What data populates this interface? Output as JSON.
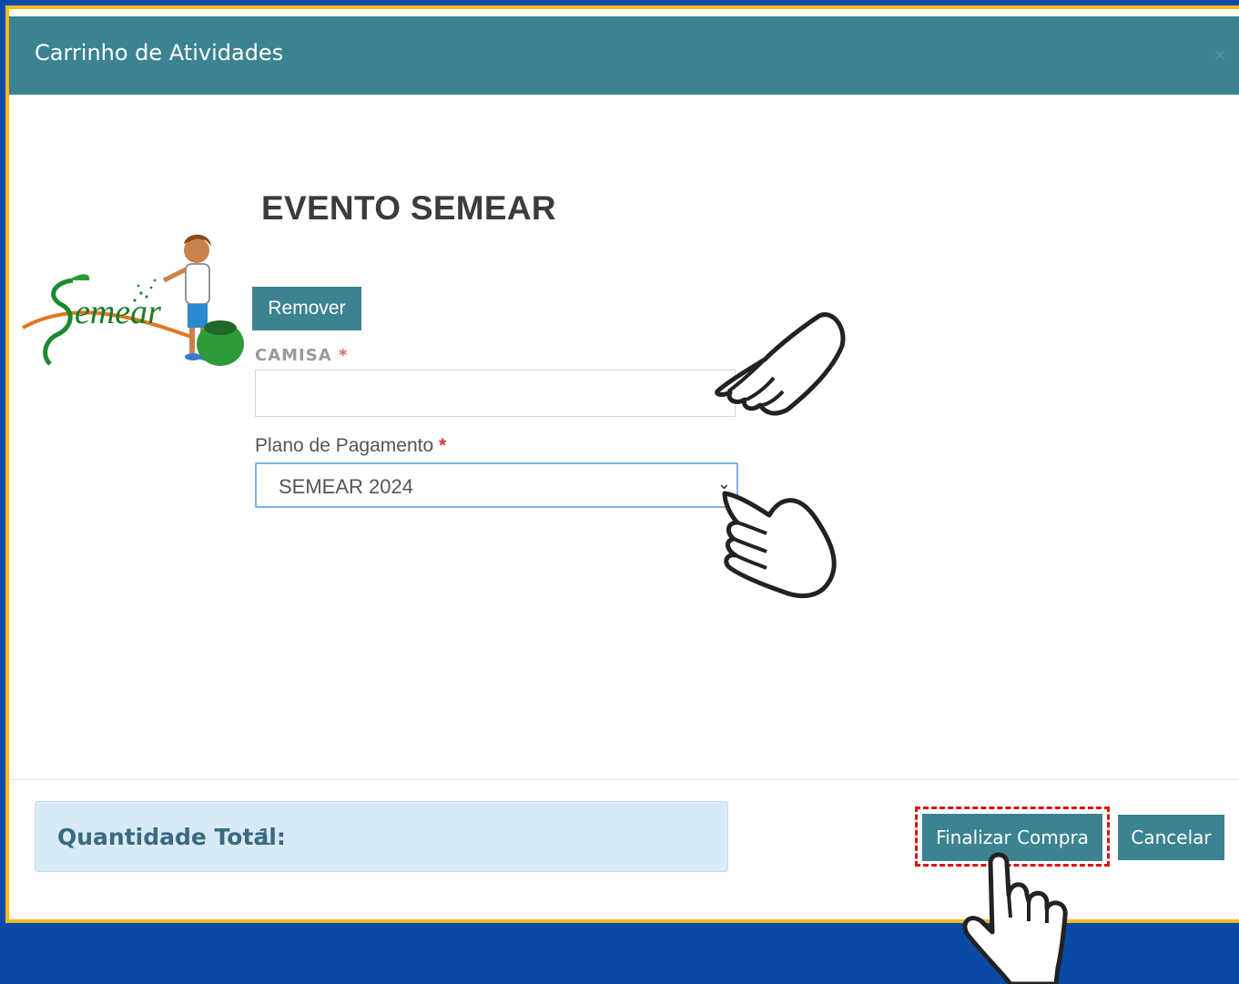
{
  "modal": {
    "title": "Carrinho de Atividades",
    "close_symbol": "×"
  },
  "logo": {
    "text": "emear",
    "initial": "S",
    "icon": "semear-logo-icon"
  },
  "event": {
    "title": "EVENTO SEMEAR",
    "remove_label": "Remover"
  },
  "form": {
    "camisa_label": "CAMISA",
    "camisa_value": "",
    "required_mark": "*",
    "plano_label": "Plano de Pagamento",
    "plano_value": "SEMEAR 2024"
  },
  "footer": {
    "quantity_label": "Quantidade Total:",
    "quantity_value": "1",
    "finalize_label": "Finalizar Compra",
    "cancel_label": "Cancelar"
  },
  "colors": {
    "background": "#0a4aa6",
    "frame_border": "#f5b91a",
    "header": "#3c8391",
    "highlight": "#e01010"
  }
}
